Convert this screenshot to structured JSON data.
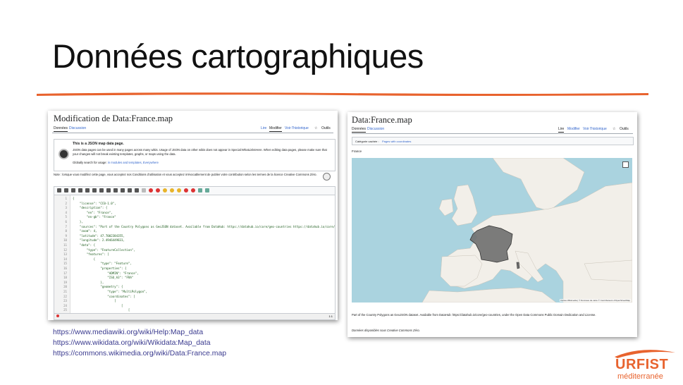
{
  "slide": {
    "title": "Données cartographiques",
    "brush_color": "#e8632e"
  },
  "editor": {
    "title": "Modification de Data:France.map",
    "tabs": [
      "Données",
      "Discussion"
    ],
    "actions": [
      "Lire",
      "Modifier",
      "Voir l'historique",
      "Outils"
    ],
    "notice_title": "This is a JSON map data page.",
    "notice_body": "JSON data pages can be used in many pages across many wikis. Usage of JSON data on other wikis does not appear in Special:WhatLinksHere. When editing data pages, please make sure that your changes will not break existing templates, graphs, or maps using the data.",
    "notice_usage_prefix": "Globally search for usage:",
    "notice_usage_links": "in modules and templates, Everywhere",
    "note": "Note : lorsque vous modifiez cette page, vous acceptez nos Conditions d'utilisation et vous acceptez irrévocablement de publier votre contribution selon les termes de la licence Creative Commons Zéro.",
    "code_lines": [
      {
        "n": "1",
        "t": "{"
      },
      {
        "n": "2",
        "t": "    \"license\": \"CC0-1.0\","
      },
      {
        "n": "3",
        "t": "    \"description\": {"
      },
      {
        "n": "4",
        "t": "        \"en\": \"France\","
      },
      {
        "n": "5",
        "t": "        \"en-gb\": \"France\""
      },
      {
        "n": "6",
        "t": "    },"
      },
      {
        "n": "7",
        "t": "    \"sources\": \"Part of the Country Polygons as GeoJSON dataset. Available from DataHub: https://datahub.io/core/geo-countries https://datahub.io/core/geo-c"
      },
      {
        "n": "8",
        "t": "    \"zoom\": 4,"
      },
      {
        "n": "9",
        "t": "    \"latitude\": 47.7002384355,"
      },
      {
        "n": "10",
        "t": "    \"longitude\": 2.4946449831,"
      },
      {
        "n": "11",
        "t": "    \"data\": {"
      },
      {
        "n": "12",
        "t": "        \"type\": \"FeatureCollection\","
      },
      {
        "n": "13",
        "t": "        \"features\": ["
      },
      {
        "n": "14",
        "t": "            {"
      },
      {
        "n": "15",
        "t": "                \"type\": \"Feature\","
      },
      {
        "n": "16",
        "t": "                \"properties\": {"
      },
      {
        "n": "17",
        "t": "                    \"ADMIN\": \"France\","
      },
      {
        "n": "18",
        "t": "                    \"ISO_A3\": \"FRA\""
      },
      {
        "n": "19",
        "t": "                },"
      },
      {
        "n": "20",
        "t": "                \"geometry\": {"
      },
      {
        "n": "21",
        "t": "                    \"type\": \"MultiPolygon\","
      },
      {
        "n": "22",
        "t": "                    \"coordinates\": ["
      },
      {
        "n": "23",
        "t": "                        ["
      },
      {
        "n": "24",
        "t": "                            ["
      },
      {
        "n": "25",
        "t": "                                ["
      }
    ],
    "status_right": "1:1"
  },
  "viewer": {
    "title": "Data:France.map",
    "tabs": [
      "Données",
      "Discussion"
    ],
    "actions": [
      "Lire",
      "Modifier",
      "Voir l'historique",
      "Outils"
    ],
    "category_prefix": "Catégorie cachée :",
    "category_link": "Pages with coordinates",
    "map_label": "France",
    "map_attribution": "Cartes Wikimedia | © Données de carte © Contributeurs d'OpenStreetMap",
    "source_text": "Part of the Country Polygons as GeoJSON dataset. Available from DataHub: https://datahub.io/core/geo-countries, under the Open Data Commons Public Domain Dedication and License.",
    "available_text": "Données disponibles sous Creative Commons Zéro."
  },
  "links": [
    "https://www.mediawiki.org/wiki/Help:Map_data",
    "https://www.wikidata.org/wiki/Wikidata:Map_data",
    "https://commons.wikimedia.org/wiki/Data:France.map"
  ],
  "logo": {
    "main": "URFIST",
    "sub": "méditerranée",
    "color": "#e8632e"
  }
}
